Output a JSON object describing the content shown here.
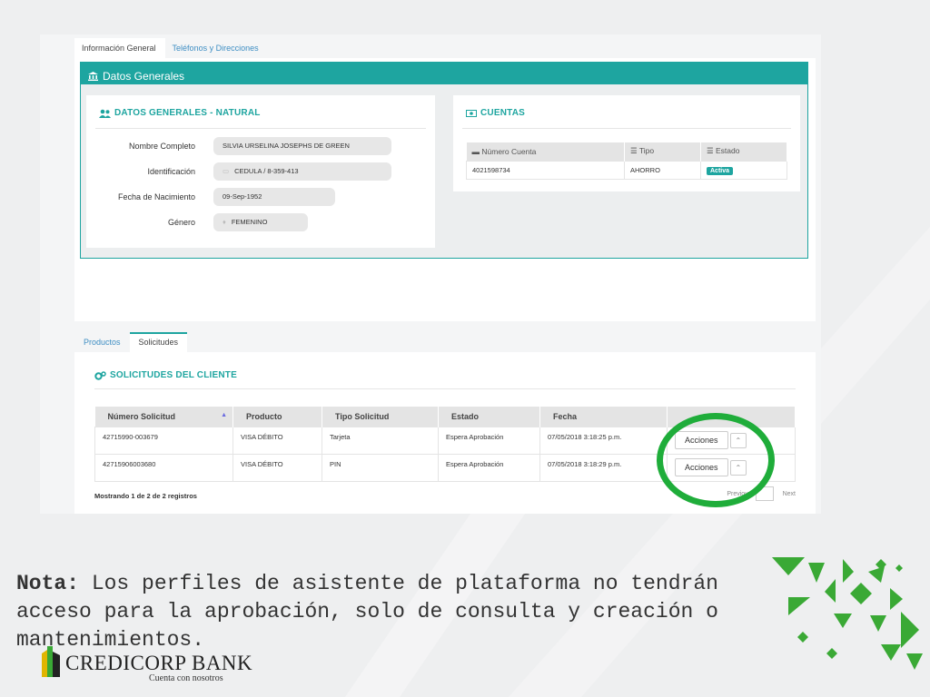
{
  "colors": {
    "teal": "#1ea5a0",
    "highlight_green": "#1fad3a",
    "brand_green": "#3aa935",
    "brand_yellow": "#e0b500"
  },
  "top_tabs": [
    {
      "label": "Información General",
      "active": true
    },
    {
      "label": "Teléfonos y Direcciones",
      "active": false
    }
  ],
  "datos_generales": {
    "header": "Datos Generales",
    "header_icon": "bank-icon",
    "natural": {
      "title": "DATOS GENERALES - NATURAL",
      "icon": "users-icon",
      "fields": [
        {
          "label": "Nombre Completo",
          "value": "SILVIA URSELINA JOSEPHS DE GREEN",
          "icon": ""
        },
        {
          "label": "Identificación",
          "value": "CEDULA / 8-359-413",
          "icon": "id-card-icon"
        },
        {
          "label": "Fecha de Nacimiento",
          "value": "09-Sep-1952",
          "icon": ""
        },
        {
          "label": "Género",
          "value": "FEMENINO",
          "icon": "gender-icon"
        }
      ]
    },
    "cuentas": {
      "title": "CUENTAS",
      "icon": "money-icon",
      "columns": [
        "Número Cuenta",
        "Tipo",
        "Estado"
      ],
      "rows": [
        {
          "numero": "4021598734",
          "tipo": "AHORRO",
          "estado": "Activa"
        }
      ]
    }
  },
  "bottom_tabs": [
    {
      "label": "Productos",
      "active": false
    },
    {
      "label": "Solicitudes",
      "active": true
    }
  ],
  "solicitudes": {
    "title": "SOLICITUDES DEL CLIENTE",
    "icon": "cogs-icon",
    "columns": [
      "Número Solicitud",
      "Producto",
      "Tipo Solicitud",
      "Estado",
      "Fecha"
    ],
    "rows": [
      {
        "numero": "42715990-003679",
        "producto": "VISA DÉBITO",
        "tipo": "Tarjeta",
        "estado": "Espera Aprobación",
        "fecha": "07/05/2018 3:18:25 p.m.",
        "accion": "Acciones"
      },
      {
        "numero": "42715906003680",
        "producto": "VISA DÉBITO",
        "tipo": "PIN",
        "estado": "Espera Aprobación",
        "fecha": "07/05/2018 3:18:29 p.m.",
        "accion": "Acciones"
      }
    ],
    "footer": "Mostrando 1 de 2 de 2 registros",
    "pager": {
      "previous": "Previous",
      "next": "Next"
    }
  },
  "note": {
    "label": "Nota:",
    "text": "Los perfiles de asistente de plataforma no tendrán acceso para la aprobación,  solo de consulta y creación o mantenimientos."
  },
  "logo": {
    "name": "CREDICORP BANK",
    "tagline": "Cuenta con nosotros"
  }
}
